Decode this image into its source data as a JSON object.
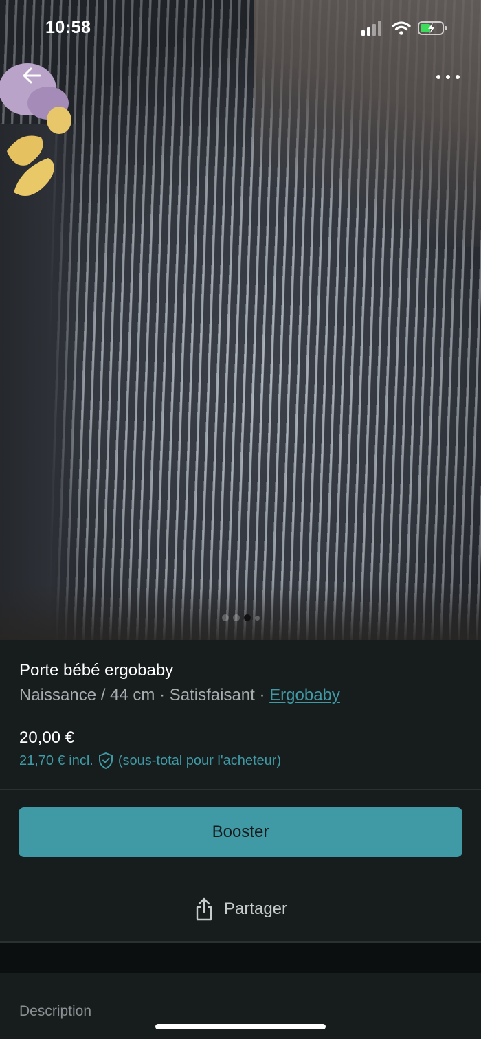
{
  "status_bar": {
    "time": "10:58"
  },
  "photo": {
    "carousel": {
      "count": 4,
      "active_index": 2
    }
  },
  "listing": {
    "title": "Porte bébé ergobaby",
    "size": "Naissance / 44 cm",
    "separator": " · ",
    "condition": "Satisfaisant",
    "brand": "Ergobaby",
    "price": "20,00 €",
    "price_incl": "21,70 € incl.",
    "price_incl_note": "(sous-total pour l'acheteur)"
  },
  "actions": {
    "booster_label": "Booster",
    "share_label": "Partager"
  },
  "description": {
    "label": "Description"
  },
  "colors": {
    "accent": "#3f9aa6",
    "background": "#171c1d"
  }
}
